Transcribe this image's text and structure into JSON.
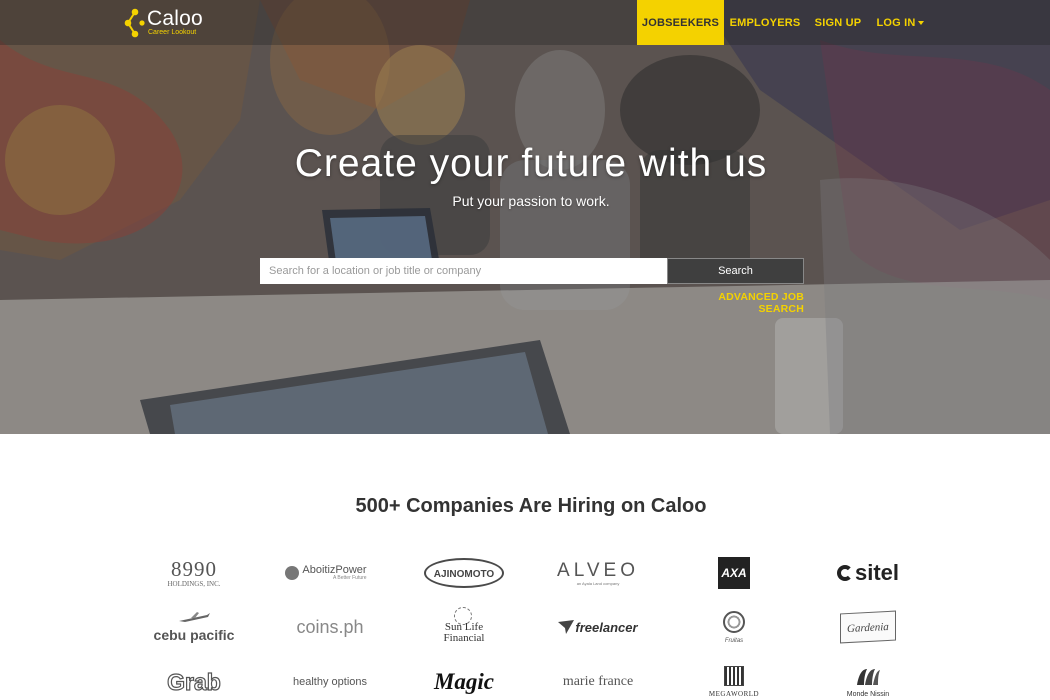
{
  "brand": {
    "name": "Caloo",
    "tagline": "Career Lookout",
    "accent": "#f4d200",
    "dark": "#3f3f3f"
  },
  "nav": {
    "items": [
      {
        "label": "JOBSEEKERS",
        "active": true
      },
      {
        "label": "EMPLOYERS",
        "active": false
      },
      {
        "label": "SIGN UP",
        "active": false
      },
      {
        "label": "LOG IN",
        "active": false,
        "has_dropdown": true
      }
    ]
  },
  "hero": {
    "title": "Create your future with us",
    "subtitle": "Put your passion to work."
  },
  "search": {
    "placeholder": "Search for a location or job title or company",
    "value": "",
    "button_label": "Search",
    "advanced_link": "ADVANCED JOB SEARCH"
  },
  "companies": {
    "heading": "500+ Companies Are Hiring on Caloo",
    "logos": [
      {
        "name": "8990",
        "sub": "HOLDINGS, INC."
      },
      {
        "name": "AboitizPower",
        "sub": "A Better Future"
      },
      {
        "name": "AJINOMOTO",
        "sub": ""
      },
      {
        "name": "ALVEO",
        "sub": "an Ayala Land company"
      },
      {
        "name": "AXA",
        "sub": ""
      },
      {
        "name": "sitel",
        "sub": ""
      },
      {
        "name": "cebu pacific",
        "sub": ""
      },
      {
        "name": "coins.ph",
        "sub": ""
      },
      {
        "name": "Sun Life Financial",
        "sub": ""
      },
      {
        "name": "freelancer",
        "sub": ""
      },
      {
        "name": "Fruitas",
        "sub": ""
      },
      {
        "name": "Gardenia",
        "sub": ""
      },
      {
        "name": "Grab",
        "sub": ""
      },
      {
        "name": "healthy options",
        "sub": ""
      },
      {
        "name": "Magic",
        "sub": ""
      },
      {
        "name": "marie france",
        "sub": ""
      },
      {
        "name": "MEGAWORLD",
        "sub": ""
      },
      {
        "name": "Monde Nissin",
        "sub": ""
      }
    ]
  }
}
